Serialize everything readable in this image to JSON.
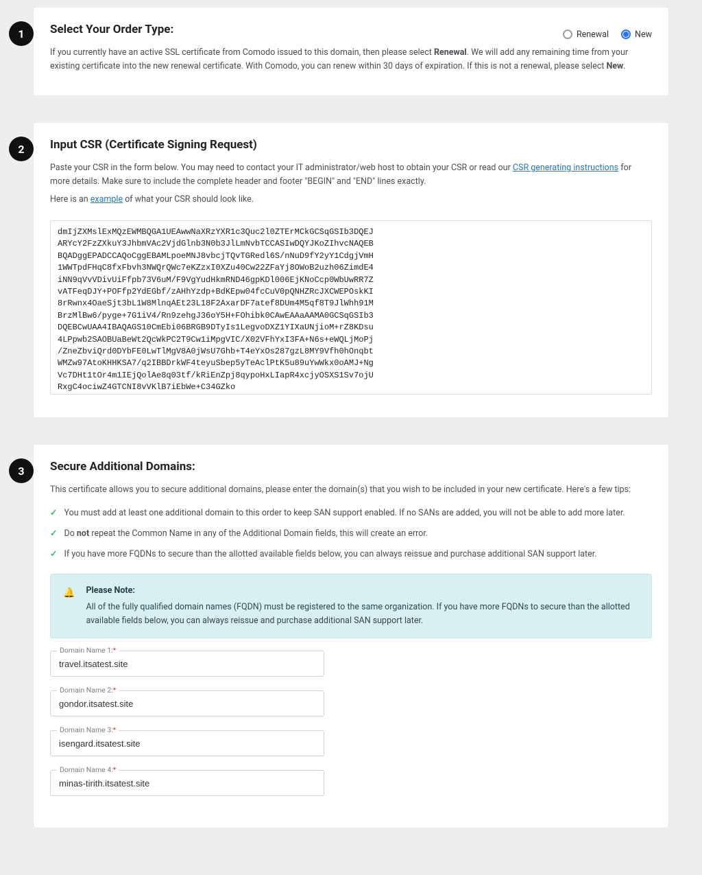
{
  "step1": {
    "number": "1",
    "title": "Select Your Order Type:",
    "radios": {
      "renewal": "Renewal",
      "new": "New"
    },
    "desc_prefix": "If you currently have an active SSL certificate from Comodo issued to this domain, then please select ",
    "desc_bold1": "Renewal",
    "desc_mid": ". We will add any remaining time from your existing certificate into the new renewal certificate. With Comodo, you can renew within 30 days of expiration. If this is not a renewal, please select ",
    "desc_bold2": "New",
    "desc_suffix": "."
  },
  "step2": {
    "number": "2",
    "title": "Input CSR (Certificate Signing Request)",
    "desc_prefix": "Paste your CSR in the form below. You may need to contact your IT administrator/web host to obtain your CSR or read our ",
    "link_csr_instructions": "CSR generating instructions",
    "desc_mid": " for more details. Make sure to include the complete header and footer \"BEGIN\" and \"END\" lines exactly.",
    "example_prefix": "Here is an ",
    "example_link": "example",
    "example_suffix": " of what your CSR should look like.",
    "csr_value": "dmIjZXMslExMQzEWMBQGA1UEAwwNaXRzYXR1c3Quc2l0ZTErMCkGCSqGSIb3DQEJ\nARYcY2FzZXkuY3JhbmVAc2VjdGlnb3N0b3JlLmNvbTCCASIwDQYJKoZIhvcNAQEB\nBQADggEPADCCAQoCggEBAMLpoeMNJ8vbcjTQvTGRedl6S/nNuD9fY2yY1CdgjVmH\n1WWTpdFHqC8fxFbvh3NWQrQWc7eKZzxI0XZu40Cw22ZFaYj8OWoB2uzh06ZimdE4\niNN9qVvVDivUiFfpb73V6uM/F9VgYudHkmRND46gpKDl006EjKNoCcp0WbUwRR7Z\nvATFeqDJY+POFfp2YdEGbf/zAHhYzdp+BdKEpw04fcCuV0pQNHZRcJXCWEPOskKI\n8rRwnx4OaeSjt3bL1W8MlnqAEt23L18F2AxarDF7atef8DUm4M5qf8T9JlWhh91M\nBrzMlBw6/pyge+7G1iV4/Rn9zehgJ36oY5H+FOhibk0CAwEAAaAAMA0GCSqGSIb3\nDQEBCwUAA4IBAQAGS10CmEbi06BRGB9DTyIs1LegvoDXZ1YIXaUNjioM+rZ8KDsu\n4LPpwb2SAOBUaBeWt2QcWkPC2T9Cw1iMpgVIC/X02VFhYxI3FA+N6s+eWQLjMoPj\n/ZneZbviQrd0DYbFE0LwTlMgV8A0jWsU7Ghb+T4eYxOs287gzL8MY9Vfh0hOnqbt\nWMZw97AtoKHHKSA7/q2IBBDrkWF4teyuSbep5yTeAclPtK5u89uYwWkx0oAMJ+Ng\nVc7DHt1tOr4m1IEjQolAe8q03tf/kRiEnZpj8qypoHxLIapR4xcjyOSXS1Sv7ojU\nRxgC4ociwZ4GTCNI8vVKlB7iEbWe+C34GZko\n-----END CERTIFICATE REQUEST-----"
  },
  "step3": {
    "number": "3",
    "title": "Secure Additional Domains:",
    "desc": "This certificate allows you to secure additional domains, please enter the domain(s) that you wish to be included in your new certificate. Here's a few tips:",
    "tip1": "You must add at least one additional domain to this order to keep SAN support enabled. If no SANs are added, you will not be able to add more later.",
    "tip2_prefix": "Do ",
    "tip2_bold": "not",
    "tip2_suffix": " repeat the Common Name in any of the Additional Domain fields, this will create an error.",
    "tip3": "If you have more FQDNs to secure than the allotted available fields below, you can always reissue and purchase additional SAN support later.",
    "note_title": "Please Note:",
    "note_body": "All of the fully qualified domain names (FQDN) must be registered to the same organization. If you have more FQDNs to secure than the allotted available fields below, you can always reissue and purchase additional SAN support later.",
    "fields": [
      {
        "label": "Domain Name 1:",
        "value": "travel.itsatest.site"
      },
      {
        "label": "Domain Name 2:",
        "value": "gondor.itsatest.site"
      },
      {
        "label": "Domain Name 3:",
        "value": "isengard.itsatest.site"
      },
      {
        "label": "Domain Name 4:",
        "value": "minas-tirith.itsatest.site"
      }
    ]
  },
  "required_marker": "*"
}
